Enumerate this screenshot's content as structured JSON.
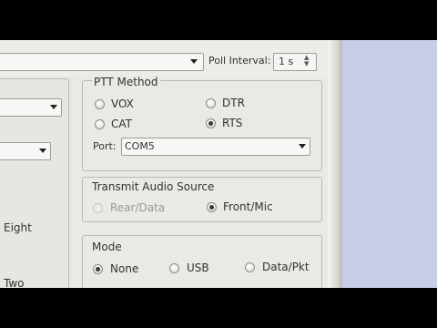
{
  "toolbar": {
    "poll_interval_label": "Poll Interval:",
    "poll_interval_value": "1 s"
  },
  "left_panel": {
    "eight_label": "Eight",
    "two_label": "Two"
  },
  "ptt": {
    "title": "PTT Method",
    "options": [
      "VOX",
      "CAT",
      "DTR",
      "RTS"
    ],
    "selected": "RTS",
    "port_label": "Port:",
    "port_value": "COM5"
  },
  "audio": {
    "title": "Transmit Audio Source",
    "options": [
      "Rear/Data",
      "Front/Mic"
    ],
    "selected": "Front/Mic"
  },
  "mode": {
    "title": "Mode",
    "options": [
      "None",
      "USB",
      "Data/Pkt"
    ],
    "selected": "None"
  }
}
